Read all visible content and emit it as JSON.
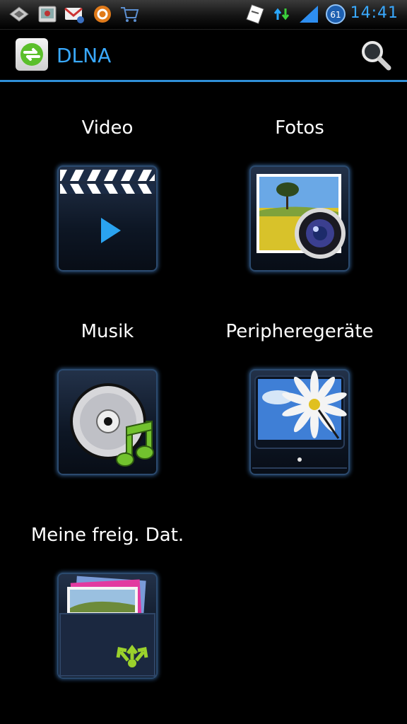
{
  "status_bar": {
    "time": "14:41",
    "battery_level": "61",
    "icons": [
      "usb-debug-icon",
      "image-app-icon",
      "gmail-icon",
      "notification-app-icon",
      "shopping-cart-icon",
      "clipboard-icon",
      "data-transfer-icon",
      "signal-icon",
      "battery-icon"
    ]
  },
  "action_bar": {
    "title": "DLNA",
    "app_icon": "dlna-app-icon",
    "search_icon": "search-icon",
    "accent_color": "#2f8fd8"
  },
  "tiles": [
    {
      "label": "Video",
      "icon": "video-clapper-icon"
    },
    {
      "label": "Fotos",
      "icon": "photo-camera-icon"
    },
    {
      "label": "Musik",
      "icon": "music-disc-icon"
    },
    {
      "label": "Peripheregeräte",
      "icon": "tv-device-icon"
    },
    {
      "label": "Meine freig. Dat.",
      "icon": "shared-files-icon"
    }
  ]
}
